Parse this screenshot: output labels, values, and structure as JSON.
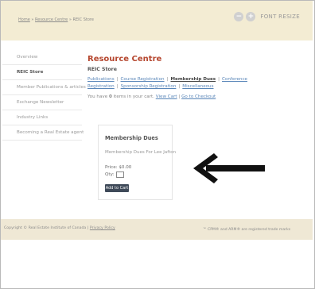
{
  "breadcrumb": {
    "items": [
      "Home",
      "Resource Centre",
      "REIC Store"
    ],
    "separator": " » "
  },
  "font_controls": {
    "decrease": "−",
    "increase": "+",
    "label": "FONT RESIZE"
  },
  "sidebar": {
    "items": [
      {
        "label": "Overview"
      },
      {
        "label": "REIC Store"
      },
      {
        "label": "Member Publications & articles"
      },
      {
        "label": "Exchange Newsletter"
      },
      {
        "label": "Industry Links"
      },
      {
        "label": "Becoming a Real Estate agent"
      }
    ]
  },
  "main": {
    "title": "Resource Centre",
    "section": "REIC Store",
    "tabs": [
      "Publications",
      "Course Registration",
      "Membership Dues",
      "Conference Registration",
      "Sponsorship Registration",
      "Miscellaneous"
    ],
    "active_tab": "Membership Dues",
    "cart": {
      "prefix": "You have",
      "count": "0",
      "suffix": "items in your cart.",
      "view_cart": "View Cart",
      "checkout": "Go to Checkout"
    }
  },
  "product": {
    "name": "Membership Dues",
    "description": "Membership Dues For Lee Jafton",
    "price_label": "Price:",
    "price": "$0.00",
    "qty_label": "Qty:",
    "add_button": "Add to Cart"
  },
  "footer": {
    "copyright": "Copyright © Real Estate Institute of Canada",
    "privacy": "Privacy Policy",
    "trademark": "™ CPM® and ARM® are registered trade marks"
  },
  "colors": {
    "header_bg": "#f3ecd3",
    "footer_bg": "#efe8d5",
    "title": "#b5462e",
    "link": "#5b87b9",
    "button": "#3f4a59"
  }
}
